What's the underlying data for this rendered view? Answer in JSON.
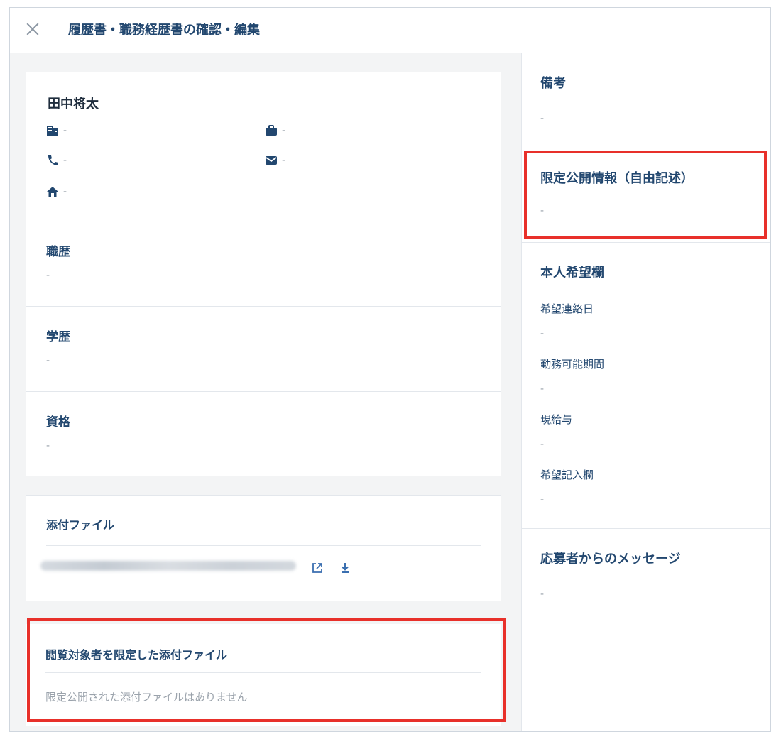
{
  "header": {
    "title": "履歴書・職務経歴書の確認・編集"
  },
  "profile": {
    "name": "田中将太",
    "company": "-",
    "job": "-",
    "phone": "-",
    "email": "-",
    "address": "-"
  },
  "career": {
    "title": "職歴",
    "value": "-"
  },
  "education": {
    "title": "学歴",
    "value": "-"
  },
  "qualification": {
    "title": "資格",
    "value": "-"
  },
  "attachments": {
    "title": "添付ファイル"
  },
  "restricted_attachments": {
    "title": "閲覧対象者を限定した添付ファイル",
    "empty_message": "限定公開された添付ファイルはありません"
  },
  "right": {
    "notes": {
      "title": "備考",
      "value": "-"
    },
    "limited_info": {
      "title": "限定公開情報（自由記述）",
      "value": "-"
    },
    "wishes": {
      "title": "本人希望欄",
      "contact_date_label": "希望連絡日",
      "contact_date": "-",
      "work_period_label": "勤務可能期間",
      "work_period": "-",
      "salary_label": "現給与",
      "salary": "-",
      "notes_label": "希望記入欄",
      "notes": "-"
    },
    "message": {
      "title": "応募者からのメッセージ",
      "value": "-"
    }
  },
  "colors": {
    "accent": "#22476f",
    "highlight": "#e8302a",
    "muted": "#9aa2ab"
  }
}
